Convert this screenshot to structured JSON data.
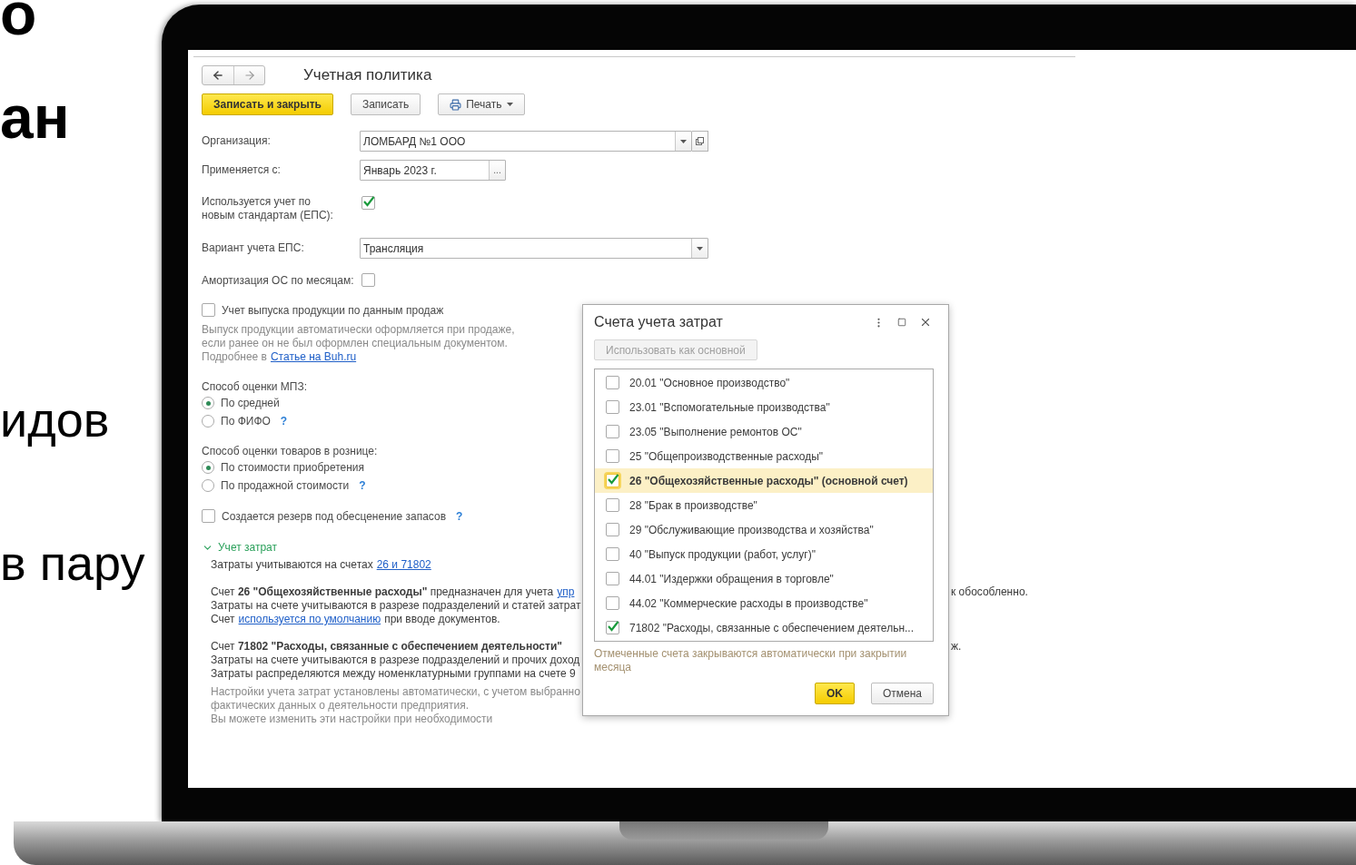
{
  "slide_text": [
    "о",
    "ан",
    "идов",
    "в пару"
  ],
  "form": {
    "title": "Учетная политика",
    "toolbar": [
      {
        "label": "Записать и закрыть",
        "kind": "primary"
      },
      {
        "label": "Записать",
        "kind": "plain"
      },
      {
        "label": "Печать",
        "kind": "menu"
      }
    ],
    "organization": {
      "label": "Организация:",
      "value": "ЛОМБАРД №1 ООО"
    },
    "applies_from": {
      "label": "Применяется с:",
      "value": "Январь 2023 г.",
      "button": "..."
    },
    "eps_used": {
      "label": "Используется учет по новым стандартам (ЕПС):",
      "checked": true
    },
    "eps_variant": {
      "label": "Вариант учета ЕПС:",
      "value": "Трансляция"
    },
    "monthly_depreciation": {
      "label": "Амортизация ОС по месяцам:",
      "checked": false
    },
    "sales_output": {
      "label": "Учет выпуска продукции по данным продаж",
      "checked": false,
      "hint_lines": [
        "Выпуск продукции автоматически оформляется при продаже,",
        "если ранее он не был оформлен специальным документом."
      ],
      "more": "Подробнее в",
      "more_link": "Статье на Buh.ru"
    },
    "mpz": {
      "label": "Способ оценки МПЗ:",
      "options": [
        {
          "label": "По средней",
          "selected": true
        },
        {
          "label": "По ФИФО",
          "selected": false,
          "help": "?"
        }
      ]
    },
    "retail": {
      "label": "Способ оценки товаров в рознице:",
      "options": [
        {
          "label": "По стоимости приобретения",
          "selected": true
        },
        {
          "label": "По продажной стоимости",
          "selected": false,
          "help": "?"
        }
      ]
    },
    "reserve": {
      "label": "Создается резерв под обесценение запасов",
      "checked": false,
      "help": "?"
    },
    "costs": {
      "title": "Учет затрат",
      "expanded": true,
      "summary": "Затраты учитываются на счетах",
      "summary_link": "26 и 71802",
      "paragraphs": [
        [
          {
            "parts": [
              {
                "text": "Счет **26 \"Общехозяйственные расходы\"** предназначен для учета"
              },
              {
                "link": "упр"
              }
            ],
            "right": "к обособленно."
          },
          {
            "parts": [
              {
                "text": "Затраты на счете учитываются в разрезе подразделений и статей затрат"
              }
            ]
          },
          {
            "parts": [
              {
                "text": "Счет"
              },
              {
                "link": "используется по умолчанию"
              },
              {
                "text": "при вводе документов."
              }
            ]
          }
        ],
        [
          {
            "parts": [
              {
                "text": "Счет **71802 \"Расходы, связанные с обеспечением деятельности\"**"
              }
            ],
            "right": "ж."
          },
          {
            "parts": [
              {
                "text": "Затраты на счете учитываются в разрезе подразделений и прочих доход"
              }
            ]
          },
          {
            "parts": [
              {
                "text": "Затраты распределяются между номенклатурными группами на счете 9"
              }
            ]
          }
        ]
      ],
      "note_lines": [
        "Настройки учета затрат установлены автоматически, с учетом выбранно",
        "фактических данных о деятельности предприятия.",
        "Вы можете изменить эти настройки при необходимости"
      ]
    }
  },
  "dialog": {
    "title": "Счета учета затрат",
    "use_as_main": {
      "label": "Использовать как основной",
      "disabled": true
    },
    "accounts": [
      {
        "label": "20.01 \"Основное производство\"",
        "checked": false,
        "selected": false
      },
      {
        "label": "23.01 \"Вспомогательные производства\"",
        "checked": false,
        "selected": false
      },
      {
        "label": "23.05 \"Выполнение ремонтов ОС\"",
        "checked": false,
        "selected": false
      },
      {
        "label": "25 \"Общепроизводственные расходы\"",
        "checked": false,
        "selected": false
      },
      {
        "label": "26 \"Общехозяйственные расходы\" (основной счет)",
        "checked": true,
        "selected": true
      },
      {
        "label": "28 \"Брак в производстве\"",
        "checked": false,
        "selected": false
      },
      {
        "label": "29 \"Обслуживающие производства и хозяйства\"",
        "checked": false,
        "selected": false
      },
      {
        "label": "40 \"Выпуск продукции (работ, услуг)\"",
        "checked": false,
        "selected": false
      },
      {
        "label": "44.01 \"Издержки обращения в торговле\"",
        "checked": false,
        "selected": false
      },
      {
        "label": "44.02 \"Коммерческие расходы в производстве\"",
        "checked": false,
        "selected": false
      },
      {
        "label": "71802 \"Расходы, связанные с обеспечением деятельн...",
        "checked": true,
        "selected": false
      }
    ],
    "hint": "Отмеченные счета закрываются автоматически при закрытии месяца",
    "buttons": [
      {
        "label": "OK",
        "kind": "primary"
      },
      {
        "label": "Отмена",
        "kind": "plain"
      }
    ]
  }
}
